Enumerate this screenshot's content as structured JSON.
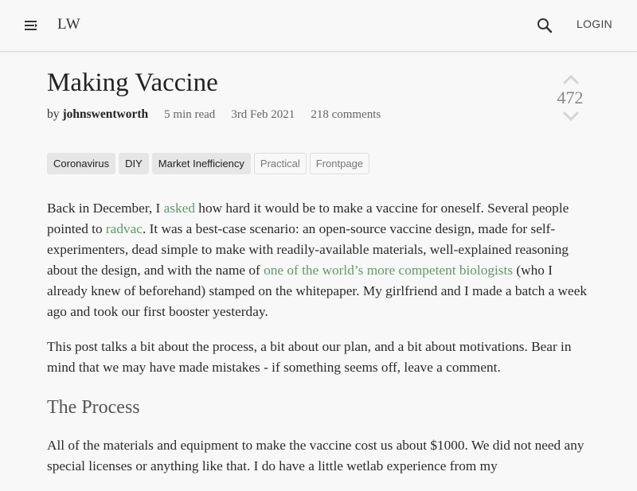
{
  "header": {
    "logo": "LW",
    "login_label": "LOGIN",
    "menu_icon": "menu-icon",
    "search_icon": "search-icon"
  },
  "post": {
    "title": "Making Vaccine",
    "by_label": "by",
    "author": "johnswentworth",
    "read_time": "5 min read",
    "date": "3rd Feb 2021",
    "comments": "218 comments",
    "score": "472"
  },
  "tags": [
    {
      "label": "Coronavirus",
      "style": "core"
    },
    {
      "label": "DIY",
      "style": "core"
    },
    {
      "label": "Market Inefficiency",
      "style": "core"
    },
    {
      "label": "Practical",
      "style": "plain"
    },
    {
      "label": "Frontpage",
      "style": "plain"
    }
  ],
  "body": {
    "p1": {
      "t1": "Back in December, I ",
      "link1": "asked",
      "t2": " how hard it would be to make a vaccine for oneself. Several people pointed to ",
      "link2": "radvac",
      "t3": ". It was a best-case scenario: an open-source vaccine design, made for self-experimenters, dead simple to make with readily-available materials, well-explained reasoning about the design, and with the name of ",
      "link3": "one of the world’s more competent biologists",
      "t4": " (who I already knew of beforehand) stamped on the whitepaper. My girlfriend and I made a batch a week ago and took our first booster yesterday."
    },
    "p2": "This post talks a bit about the process, a bit about our plan, and a bit about motivations. Bear in mind that we may have made mistakes - if something seems off, leave a comment.",
    "heading": "The Process",
    "p3": "All of the materials and equipment to make the vaccine cost us about $1000. We did not need any special licenses or anything like that. I do have a little wetlab experience from my"
  },
  "colors": {
    "link": "#5f9b65",
    "background": "#f8f8f8"
  }
}
